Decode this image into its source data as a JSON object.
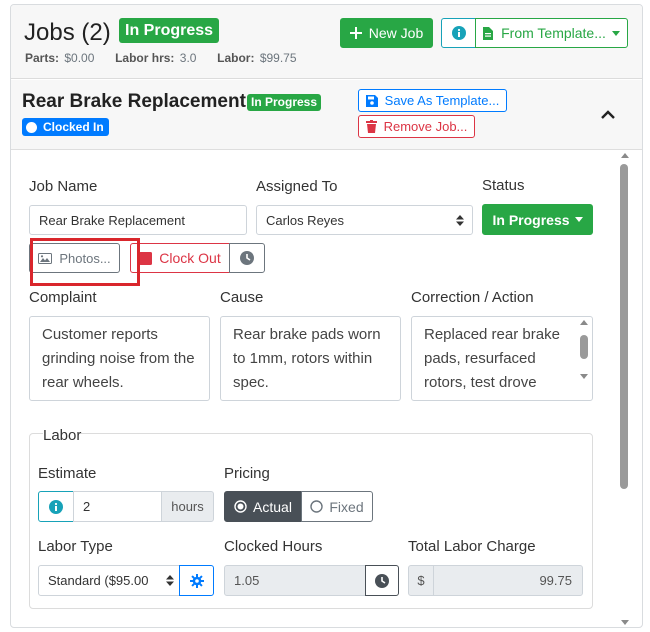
{
  "header": {
    "title": "Jobs (2)",
    "status_badge": "In Progress",
    "summary": {
      "parts_label": "Parts:",
      "parts_value": "$0.00",
      "labor_hrs_label": "Labor hrs:",
      "labor_hrs_value": "3.0",
      "labor_label": "Labor:",
      "labor_value": "$99.75"
    },
    "new_job_label": "New Job",
    "from_template_label": "From Template..."
  },
  "job": {
    "title": "Rear Brake Replacement",
    "status_badge": "In Progress",
    "clock_badge": "Clocked In",
    "save_template_label": "Save As Template...",
    "remove_job_label": "Remove Job..."
  },
  "form": {
    "job_name_label": "Job Name",
    "job_name_value": "Rear Brake Replacement",
    "assigned_to_label": "Assigned To",
    "assigned_to_value": "Carlos Reyes",
    "status_label": "Status",
    "status_value": "In Progress",
    "photos_label": "Photos...",
    "clock_out_label": "Clock Out",
    "complaint_label": "Complaint",
    "complaint_value": "Customer reports grinding noise from the rear wheels.",
    "cause_label": "Cause",
    "cause_value": "Rear brake pads worn to 1mm, rotors within spec.",
    "correction_label": "Correction / Action",
    "correction_value": "Replaced rear brake pads, resurfaced rotors, test drove"
  },
  "labor": {
    "legend": "Labor",
    "estimate_label": "Estimate",
    "estimate_value": "2",
    "estimate_unit": "hours",
    "pricing_label": "Pricing",
    "pricing_options": [
      "Actual",
      "Fixed"
    ],
    "pricing_selected": "Actual",
    "labor_type_label": "Labor Type",
    "labor_type_value": "Standard ($95.00",
    "clocked_hours_label": "Clocked Hours",
    "clocked_hours_value": "1.05",
    "total_label": "Total Labor Charge",
    "currency_symbol": "$",
    "total_value": "99.75"
  },
  "colors": {
    "success": "#28a745",
    "primary": "#007bff",
    "info": "#17a2b8",
    "danger": "#dc3545",
    "highlight": "#d9262c"
  },
  "icons": [
    "plus-icon",
    "info-icon",
    "file-icon",
    "caret-down-icon",
    "save-icon",
    "trash-icon",
    "chevron-up-icon",
    "image-icon",
    "stop-icon",
    "clock-icon",
    "gear-icon"
  ]
}
